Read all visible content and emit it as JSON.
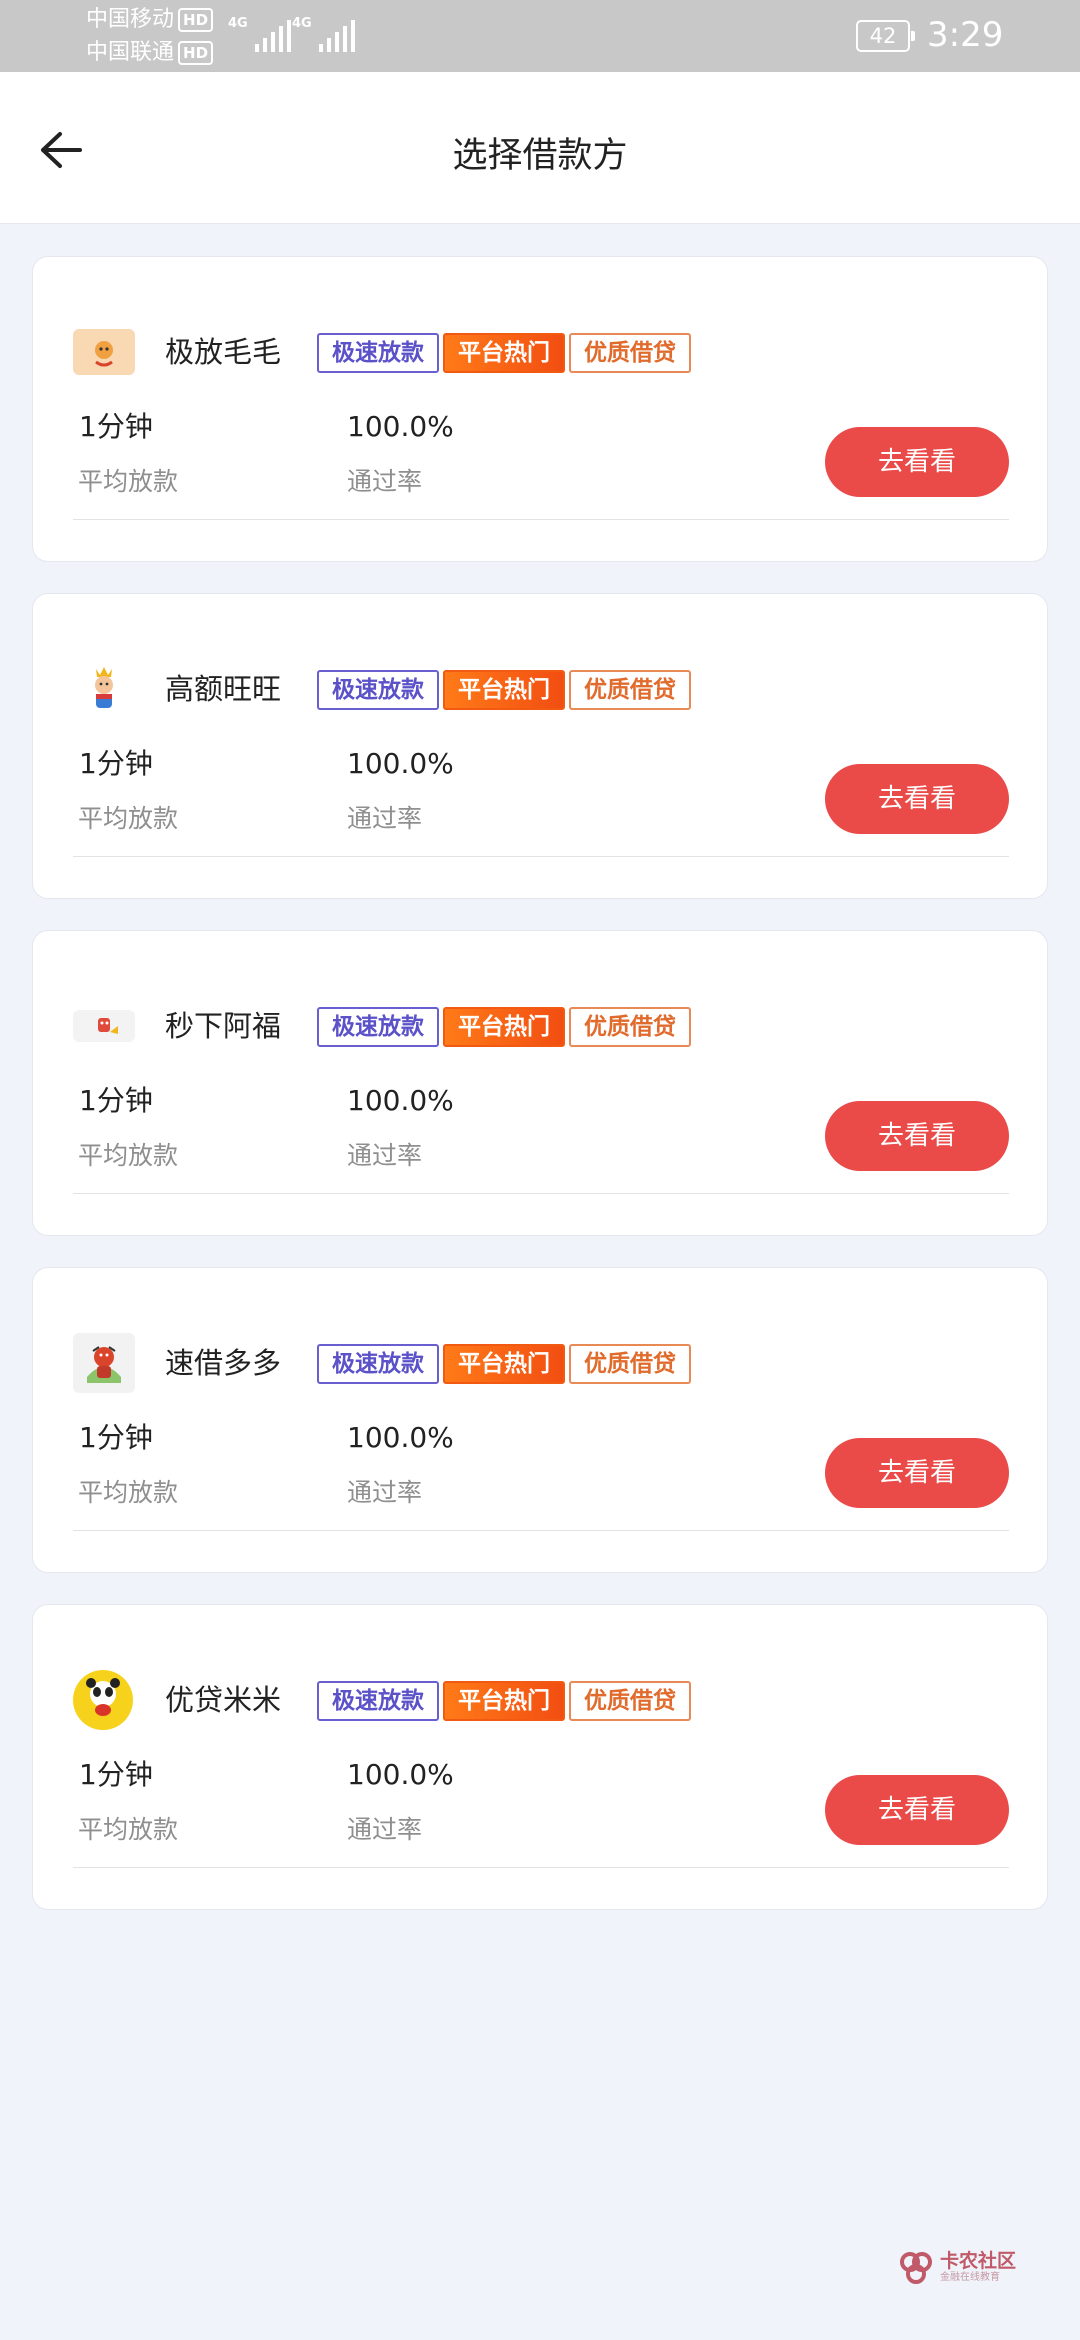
{
  "status_bar": {
    "carrier_1": "中国移动",
    "carrier_2": "中国联通",
    "hd_badge": "HD",
    "network_1": "4G",
    "network_2": "4G",
    "battery": "42",
    "time": "3:29"
  },
  "header": {
    "title": "选择借款方",
    "back_icon": "arrow-left-icon"
  },
  "tags": {
    "speed": "极速放款",
    "hot": "平台热门",
    "quality": "优质借贷"
  },
  "stats": {
    "loan_time_label": "平均放款",
    "pass_rate_label": "通过率"
  },
  "button_label": "去看看",
  "lenders": [
    {
      "name": "极放毛毛",
      "loan_time": "1分钟",
      "pass_rate": "100.0%"
    },
    {
      "name": "高额旺旺",
      "loan_time": "1分钟",
      "pass_rate": "100.0%"
    },
    {
      "name": "秒下阿福",
      "loan_time": "1分钟",
      "pass_rate": "100.0%"
    },
    {
      "name": "速借多多",
      "loan_time": "1分钟",
      "pass_rate": "100.0%"
    },
    {
      "name": "优贷米米",
      "loan_time": "1分钟",
      "pass_rate": "100.0%"
    }
  ],
  "colors": {
    "button": "#ea4a48",
    "tag_speed": "#5b51c8",
    "tag_hot": "#f25a12",
    "tag_quality": "#e06b2c",
    "background": "#f0f3fa"
  },
  "watermark": {
    "title": "卡农社区",
    "subtitle": "金融在线教育"
  }
}
